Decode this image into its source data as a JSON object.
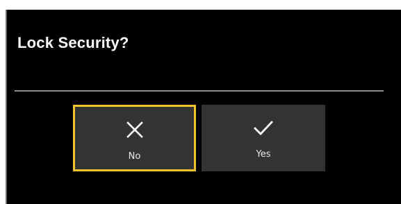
{
  "dialog": {
    "title": "Lock Security?"
  },
  "buttons": {
    "no": {
      "label": "No",
      "icon": "close-icon",
      "focused": true
    },
    "yes": {
      "label": "Yes",
      "icon": "checkmark-icon",
      "focused": false
    }
  },
  "colors": {
    "background": "#000000",
    "button": "#333333",
    "focus_border": "#f2c12e",
    "text": "#ffffff"
  }
}
